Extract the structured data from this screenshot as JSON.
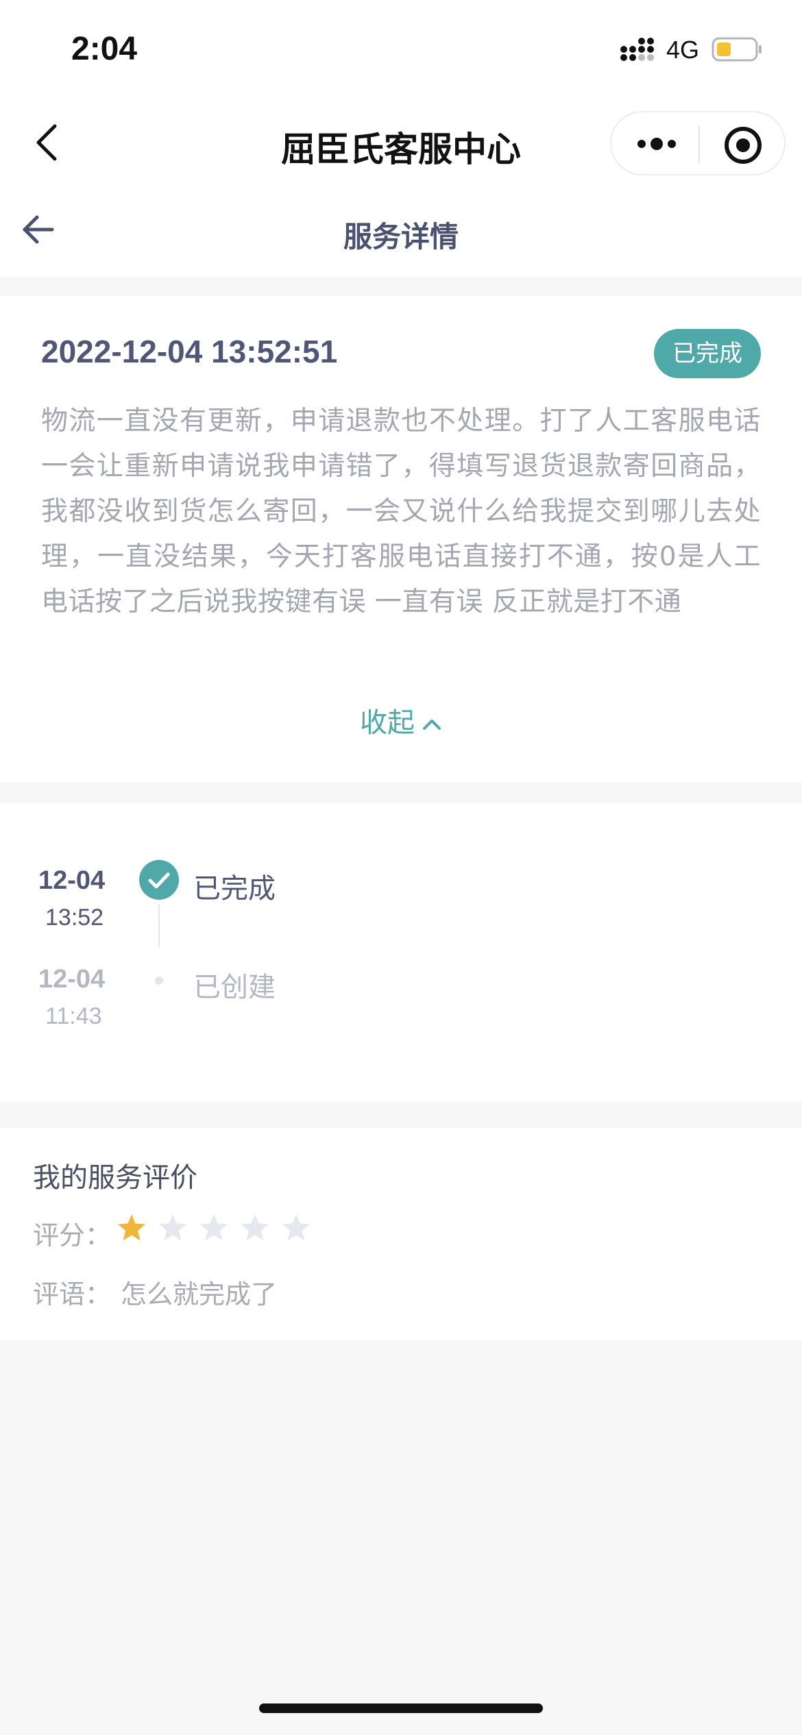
{
  "status_bar": {
    "time": "2:04",
    "network": "4G"
  },
  "navbar": {
    "title": "屈臣氏客服中心"
  },
  "subheader": {
    "title": "服务详情"
  },
  "service": {
    "datetime": "2022-12-04 13:52:51",
    "status_badge": "已完成",
    "description": "物流一直没有更新，申请退款也不处理。打了人工客服电话一会让重新申请说我申请错了，得填写退货退款寄回商品，我都没收到货怎么寄回，一会又说什么给我提交到哪儿去处理，一直没结果，今天打客服电话直接打不通，按0是人工电话按了之后说我按键有误 一直有误 反正就是打不通",
    "collapse_label": "收起"
  },
  "timeline": [
    {
      "date": "12-04",
      "time": "13:52",
      "status": "已完成",
      "active": true
    },
    {
      "date": "12-04",
      "time": "11:43",
      "status": "已创建",
      "active": false
    }
  ],
  "rating": {
    "title": "我的服务评价",
    "score_label": "评分：",
    "score": 1,
    "max_score": 5,
    "comment_label": "评语：",
    "comment": "怎么就完成了"
  },
  "colors": {
    "accent": "#4ea9a8",
    "star_filled": "#f0b63a",
    "star_empty": "#e6e8f0",
    "primary_text": "#4f5676"
  }
}
